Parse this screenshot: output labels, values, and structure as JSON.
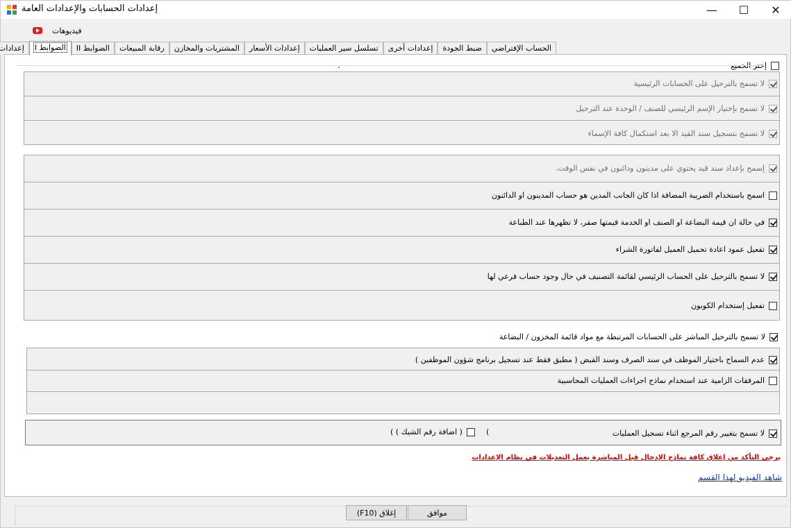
{
  "window": {
    "title": "إعدادات الحسابات والإعدادات العامة",
    "minimize": "—",
    "maximize": "☐",
    "close": "✕"
  },
  "videos": {
    "label": "فيديوهات",
    "icon": "youtube-icon"
  },
  "tabs": [
    {
      "label": "الحساب الإفتراضي"
    },
    {
      "label": "ضبط الجودة"
    },
    {
      "label": "إعدادات أخرى"
    },
    {
      "label": "تسلسل سير العمليات"
    },
    {
      "label": "إعدادات الأسعار"
    },
    {
      "label": "المشتريات والمخازن"
    },
    {
      "label": "رقابة المبيعات"
    },
    {
      "label": "الضوابط II"
    },
    {
      "label": "الضوابط I"
    },
    {
      "label": "إعدادات عامة"
    }
  ],
  "active_tab": "الضوابط I",
  "select_all": {
    "label": "إختر الجميع",
    "checked": false
  },
  "separator_text": ".",
  "group1": [
    {
      "label": "لا تسمح بالترحيل على الحسابات الرئيسية",
      "checked": true
    },
    {
      "label": "لا تسمح بإختيار الإسم الرئيسي للصنف / الوحدة عند الترحيل",
      "checked": true
    },
    {
      "label": "لا تسمح بتسجيل سند القيد الا بعد استكمال كافة الإسماء",
      "checked": true
    }
  ],
  "group2": [
    {
      "label": "إسمح بإعداد سند قيد يحتوي على مدينون ودائنون في نفس الوقت.",
      "checked": true,
      "disabled": true
    },
    {
      "label": "اسمح باستخدام الضريبة المضافة اذا كان الجانب المدين هو حساب المدينون او الدائنون",
      "checked": false
    },
    {
      "label": "في حالة ان قيمة البضاعة او الصنف او الخدمة قيمتها صفر، لا تظهرها عند الطباعة",
      "checked": true
    },
    {
      "label": "تفعيل عمود اعادة تحميل العميل لفاتورة الشراء",
      "checked": true
    },
    {
      "label": "لا تسمح بالترحيل على الحساب الرئيسي لقائمة التصنيف في حال وجود حساب فرعي لها",
      "checked": true
    },
    {
      "label": "تفعيل إستخدام الكوبون",
      "checked": false
    }
  ],
  "direct_posting": {
    "label": "لا تسمح بالترحيل المباشر على الحسابات المرتبطة مع مواد قائمة المخزون / البضاعة",
    "checked": true
  },
  "group3": [
    {
      "label": "عدم السماح باختيار الموظف في سند الصرف وسند القبض ( مطبق فقط عند تسجيل برنامج شؤون الموظفين )",
      "checked": true
    },
    {
      "label": "المرفقات الزامية عند استخدام نماذج اجراءات العمليات المحاسبية",
      "checked": false
    }
  ],
  "reference": {
    "label": "لا تسمح بتغيير رقم المرجع اثناء تسجيل العمليات",
    "checked": true,
    "paren_open": "(",
    "cheque_label": "( اضافة رقم الشيك ) )",
    "cheque_checked": false
  },
  "warning": "يرجى التأكد من إغلاق كافة نماذج الإدخال قبل المباشرة بعمل التعديلات في نظام الإعدادات",
  "video_section": "شاهد الفيديو لهذا القسم",
  "buttons": {
    "ok": "موافق",
    "close": "إغلاق (F10)"
  }
}
